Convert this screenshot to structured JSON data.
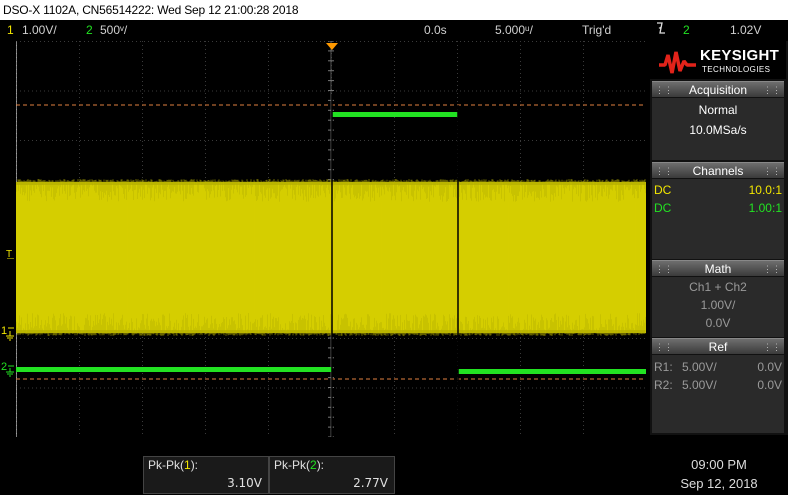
{
  "title_bar": {
    "text": "DSO-X 1102A, CN56514222: Wed Sep 12 21:00:28 2018"
  },
  "status_bar": {
    "ch1_num": "1",
    "ch1_scale": "1.00V/",
    "ch2_num": "2",
    "ch2_scale": "500ᵛ/",
    "time_delay": "0.0s",
    "time_scale": "5.000ᵘ/",
    "trigger_state": "Trig'd",
    "trigger_slope_icon": "falling-edge-icon",
    "trigger_source": "2",
    "trigger_level": "1.02V"
  },
  "colors": {
    "channel1": "#f2e600",
    "channel2": "#22e222",
    "cursor_dashed": "#e08040",
    "grid": "#555555",
    "trigger_marker": "#ff9900"
  },
  "screen": {
    "ch1_marker_label": "1",
    "ch2_marker_label": "2",
    "trigger_level_marker": "T"
  },
  "right_panel": {
    "logo_text": "KEYSIGHT",
    "logo_subtext": "TECHNOLOGIES",
    "acquisition": {
      "title": "Acquisition",
      "mode": "Normal",
      "rate": "10.0MSa/s"
    },
    "channels": {
      "title": "Channels",
      "rows": [
        {
          "coupling": "DC",
          "probe": "10.0:1"
        },
        {
          "coupling": "DC",
          "probe": "1.00:1"
        }
      ]
    },
    "math": {
      "title": "Math",
      "function": "Ch1 + Ch2",
      "scale": "1.00V/",
      "offset": "0.0V"
    },
    "ref": {
      "title": "Ref",
      "rows": [
        {
          "name": "R1:",
          "scale": "5.00V/",
          "offset": "0.0V"
        },
        {
          "name": "R2:",
          "scale": "5.00V/",
          "offset": "0.0V"
        }
      ]
    }
  },
  "measurements": [
    {
      "label_prefix": "Pk-Pk(",
      "channel": "1",
      "label_suffix": "):",
      "value": "3.10V"
    },
    {
      "label_prefix": "Pk-Pk(",
      "channel": "2",
      "label_suffix": "):",
      "value": "2.77V"
    }
  ],
  "clock": {
    "time": "09:00 PM",
    "date": "Sep 12, 2018"
  }
}
